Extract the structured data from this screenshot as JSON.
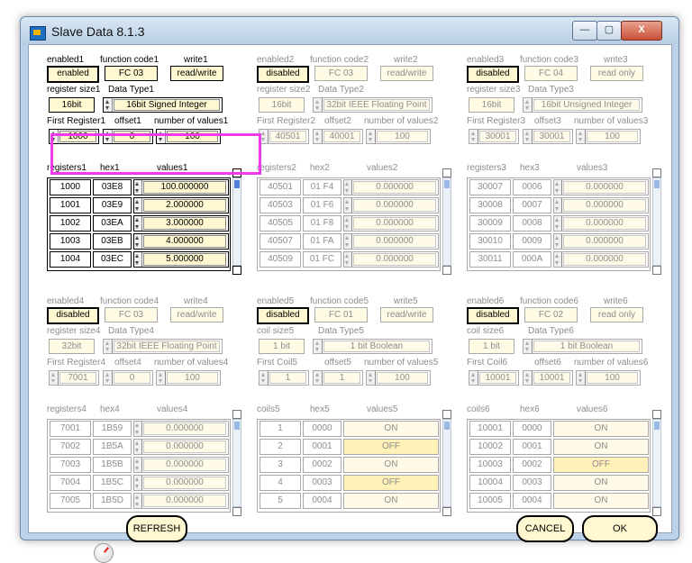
{
  "window": {
    "title": "Slave Data 8.1.3",
    "min_symbol": "—",
    "max_symbol": "▢",
    "close_symbol": "X"
  },
  "panels": [
    {
      "enabled_label": "enabled1",
      "enabled_value": "enabled",
      "fc_label": "function code1",
      "fc_value": "FC 03",
      "write_label": "write1",
      "write_value": "read/write",
      "size_label": "register size1",
      "size_value": "16bit",
      "type_label": "Data Type1",
      "type_value": "16bit Signed Integer",
      "first_label": "First Register1",
      "first_value": "1000",
      "offset_label": "offset1",
      "offset_value": "0",
      "count_label": "number of values1",
      "count_value": "100",
      "col1_label": "registers1",
      "col2_label": "hex1",
      "col3_label": "values1",
      "rows": [
        {
          "a": "1000",
          "h": "03E8",
          "v": "100.000000"
        },
        {
          "a": "1001",
          "h": "03E9",
          "v": "2.000000"
        },
        {
          "a": "1002",
          "h": "03EA",
          "v": "3.000000"
        },
        {
          "a": "1003",
          "h": "03EB",
          "v": "4.000000"
        },
        {
          "a": "1004",
          "h": "03EC",
          "v": "5.000000"
        }
      ]
    },
    {
      "enabled_label": "enabled2",
      "enabled_value": "disabled",
      "fc_label": "function code2",
      "fc_value": "FC 03",
      "write_label": "write2",
      "write_value": "read/write",
      "size_label": "register size2",
      "size_value": "16bit",
      "type_label": "Data Type2",
      "type_value": "32bit IEEE Floating Point",
      "first_label": "First Register2",
      "first_value": "40501",
      "offset_label": "offset2",
      "offset_value": "40001",
      "count_label": "number of values2",
      "count_value": "100",
      "col1_label": "registers2",
      "col2_label": "hex2",
      "col3_label": "values2",
      "rows": [
        {
          "a": "40501",
          "h": "01 F4",
          "v": "0.000000"
        },
        {
          "a": "40503",
          "h": "01 F6",
          "v": "0.000000"
        },
        {
          "a": "40505",
          "h": "01 F8",
          "v": "0.000000"
        },
        {
          "a": "40507",
          "h": "01 FA",
          "v": "0.000000"
        },
        {
          "a": "40509",
          "h": "01 FC",
          "v": "0.000000"
        }
      ]
    },
    {
      "enabled_label": "enabled3",
      "enabled_value": "disabled",
      "fc_label": "function code3",
      "fc_value": "FC 04",
      "write_label": "write3",
      "write_value": "read only",
      "size_label": "register size3",
      "size_value": "16bit",
      "type_label": "Data Type3",
      "type_value": "16bit Unsigned Integer",
      "first_label": "First Register3",
      "first_value": "30001",
      "offset_label": "offset3",
      "offset_value": "30001",
      "count_label": "number of values3",
      "count_value": "100",
      "col1_label": "registers3",
      "col2_label": "hex3",
      "col3_label": "values3",
      "rows": [
        {
          "a": "30007",
          "h": "0006",
          "v": "0.000000"
        },
        {
          "a": "30008",
          "h": "0007",
          "v": "0.000000"
        },
        {
          "a": "30009",
          "h": "0008",
          "v": "0.000000"
        },
        {
          "a": "30010",
          "h": "0009",
          "v": "0.000000"
        },
        {
          "a": "30011",
          "h": "000A",
          "v": "0.000000"
        }
      ]
    },
    {
      "enabled_label": "enabled4",
      "enabled_value": "disabled",
      "fc_label": "function code4",
      "fc_value": "FC 03",
      "write_label": "write4",
      "write_value": "read/write",
      "size_label": "register size4",
      "size_value": "32bit",
      "type_label": "Data Type4",
      "type_value": "32bit IEEE Floating Point",
      "first_label": "First Register4",
      "first_value": "7001",
      "offset_label": "offset4",
      "offset_value": "0",
      "count_label": "number of values4",
      "count_value": "100",
      "col1_label": "registers4",
      "col2_label": "hex4",
      "col3_label": "values4",
      "rows": [
        {
          "a": "7001",
          "h": "1B59",
          "v": "0.000000"
        },
        {
          "a": "7002",
          "h": "1B5A",
          "v": "0.000000"
        },
        {
          "a": "7003",
          "h": "1B5B",
          "v": "0.000000"
        },
        {
          "a": "7004",
          "h": "1B5C",
          "v": "0.000000"
        },
        {
          "a": "7005",
          "h": "1B5D",
          "v": "0.000000"
        }
      ]
    },
    {
      "enabled_label": "enabled5",
      "enabled_value": "disabled",
      "fc_label": "function code5",
      "fc_value": "FC 01",
      "write_label": "write5",
      "write_value": "read/write",
      "size_label": "coil size5",
      "size_value": "1 bit",
      "type_label": "Data Type5",
      "type_value": "1 bit Boolean",
      "first_label": "First Coil5",
      "first_value": "1",
      "offset_label": "offset5",
      "offset_value": "1",
      "count_label": "number of values5",
      "count_value": "100",
      "col1_label": "coils5",
      "col2_label": "hex5",
      "col3_label": "values5",
      "rows": [
        {
          "a": "1",
          "h": "0000",
          "v": "ON"
        },
        {
          "a": "2",
          "h": "0001",
          "v": "OFF"
        },
        {
          "a": "3",
          "h": "0002",
          "v": "ON"
        },
        {
          "a": "4",
          "h": "0003",
          "v": "OFF"
        },
        {
          "a": "5",
          "h": "0004",
          "v": "ON"
        }
      ]
    },
    {
      "enabled_label": "enabled6",
      "enabled_value": "disabled",
      "fc_label": "function code6",
      "fc_value": "FC 02",
      "write_label": "write6",
      "write_value": "read only",
      "size_label": "coil size6",
      "size_value": "1 bit",
      "type_label": "Data Type6",
      "type_value": "1 bit Boolean",
      "first_label": "First Coil6",
      "first_value": "10001",
      "offset_label": "offset6",
      "offset_value": "10001",
      "count_label": "number of values6",
      "count_value": "100",
      "col1_label": "coils6",
      "col2_label": "hex6",
      "col3_label": "values6",
      "rows": [
        {
          "a": "10001",
          "h": "0000",
          "v": "ON"
        },
        {
          "a": "10002",
          "h": "0001",
          "v": "ON"
        },
        {
          "a": "10003",
          "h": "0002",
          "v": "OFF"
        },
        {
          "a": "10004",
          "h": "0003",
          "v": "ON"
        },
        {
          "a": "10005",
          "h": "0004",
          "v": "ON"
        }
      ]
    }
  ],
  "footer": {
    "refresh_label": "REFRESH",
    "cancel_label": "CANCEL",
    "ok_label": "OK"
  },
  "colors": {
    "highlight": "#ee3bee",
    "control_fill": "#fff8d0"
  }
}
